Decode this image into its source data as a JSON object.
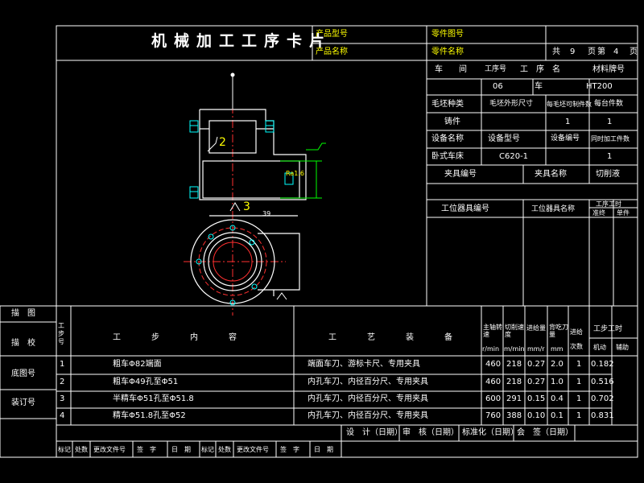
{
  "header": {
    "title": "机械加工工序卡片",
    "product_model_label": "产品型号",
    "product_name_label": "产品名称",
    "part_drawing_label": "零件图号",
    "part_name_label": "零件名称",
    "total_label": "共",
    "total_pages": "9",
    "page_label": "页",
    "page_prefix": "第",
    "page_no": "4",
    "page_suffix": "页"
  },
  "info": {
    "workshop_label": "车　　间",
    "process_no_label": "工序号",
    "process_name_label": "工　序　名",
    "material_label": "材料牌号",
    "process_no": "06",
    "process_name": "车",
    "material": "HT200",
    "blank_type_label": "毛坯种类",
    "blank_size_label": "毛坯外形尺寸",
    "per_blank_label": "每毛坯可制件数",
    "per_unit_label": "每台件数",
    "blank_type": "铸件",
    "per_blank": "1",
    "per_unit": "1",
    "equip_name_label": "设备名称",
    "equip_model_label": "设备型号",
    "equip_no_label": "设备编号",
    "simul_label": "同时加工件数",
    "equip_name": "卧式车床",
    "equip_model": "C620-1",
    "simul": "1",
    "fixture_no_label": "夹具编号",
    "fixture_name_label": "夹具名称",
    "coolant_label": "切削液",
    "station_tool_no_label": "工位器具编号",
    "station_tool_name_label": "工位器具名称",
    "hours_label": "工序工时",
    "hours_std": "准终",
    "hours_unit": "单件"
  },
  "side": {
    "draw_label": "描　图",
    "check_label": "描　校",
    "base_no_label": "底图号",
    "bind_no_label": "装订号"
  },
  "steps_header": {
    "no_label": "工步号",
    "content_label": "工　步　内　容",
    "equip_label": "工　艺　装　备",
    "speed_label": "主轴转速",
    "speed_unit": "r/min",
    "cut_speed_label": "切削速度",
    "cut_speed_unit": "m/min",
    "feed_label": "进给量",
    "feed_unit": "mm/r",
    "depth_label": "背吃刀量",
    "depth_unit": "mm",
    "passes_label": "进给次数",
    "time_label": "工步工时",
    "machine_label": "机动",
    "aux_label": "辅助"
  },
  "steps": [
    {
      "no": "1",
      "content": "粗车Φ82端面",
      "equip": "端面车刀、游标卡尺、专用夹具",
      "speed": "460",
      "vc": "218",
      "f": "0.27",
      "ap": "2.0",
      "n": "1",
      "tm": "0.182"
    },
    {
      "no": "2",
      "content": "粗车Φ49孔至Φ51",
      "equip": "内孔车刀、内径百分尺、专用夹具",
      "speed": "460",
      "vc": "218",
      "f": "0.27",
      "ap": "1.0",
      "n": "1",
      "tm": "0.516"
    },
    {
      "no": "3",
      "content": "半精车Φ51孔至Φ51.8",
      "equip": "内孔车刀、内径百分尺、专用夹具",
      "speed": "600",
      "vc": "291",
      "f": "0.15",
      "ap": "0.4",
      "n": "1",
      "tm": "0.702"
    },
    {
      "no": "4",
      "content": "精车Φ51.8孔至Φ52",
      "equip": "内孔车刀、内径百分尺、专用夹具",
      "speed": "760",
      "vc": "388",
      "f": "0.10",
      "ap": "0.1",
      "n": "1",
      "tm": "0.831"
    }
  ],
  "footer": {
    "design_label": "设　计（日期）",
    "review_label": "审　核（日期）",
    "standard_label": "标准化（日期）",
    "sign_label": "会　签（日期）",
    "mark1": "标记",
    "count1": "处数",
    "change1": "更改文件号",
    "sign1": "签　字",
    "date1": "日　期",
    "mark2": "标记",
    "count2": "处数",
    "change2": "更改文件号",
    "sign2": "签　字",
    "date2": "日　期"
  },
  "drawing": {
    "step_label": "2",
    "ref_label": "3",
    "roughness": "Ra1.6",
    "dim_top": "39"
  }
}
